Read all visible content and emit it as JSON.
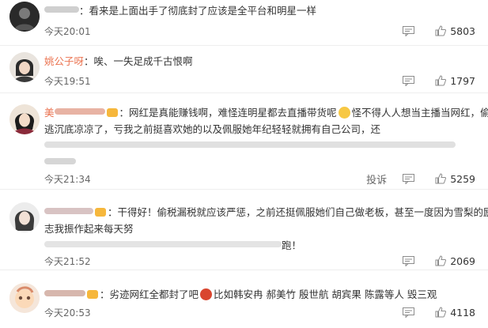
{
  "comments": [
    {
      "username": "",
      "text": "：看来是上面出手了彻底封了应该是全平台和明星一样",
      "time": "今天20:01",
      "likes": "5803"
    },
    {
      "username": "姚公子呀",
      "text": "：唉、一失足成千古恨啊",
      "time": "今天19:51",
      "likes": "1797"
    },
    {
      "username": "美",
      "text_a": "：网红是真能赚钱啊，难怪连明星都去直播带货呢",
      "text_b": "怪不得人人想当主播当网红，偷",
      "text_c": "逃沉底凉凉了，亏我之前挺喜欢她的以及佩服她年纪轻轻就拥有自己公司，还",
      "time": "今天21:34",
      "report": "投诉",
      "likes": "5259"
    },
    {
      "text_a": "：干得好！偷税漏税就应该严惩，之前还挺佩服她们自己做老板，甚至一度因为雪梨的励",
      "text_b": "志我振作起来每天努",
      "text_c": "跑！",
      "time": "今天21:52",
      "likes": "2069"
    },
    {
      "text_a": "：劣迹网红全都封了吧",
      "text_b": "比如韩安冉 郝美竹 殷世航 胡宾果 陈露等人 毁三观",
      "time": "今天20:53",
      "likes": "4118"
    }
  ]
}
